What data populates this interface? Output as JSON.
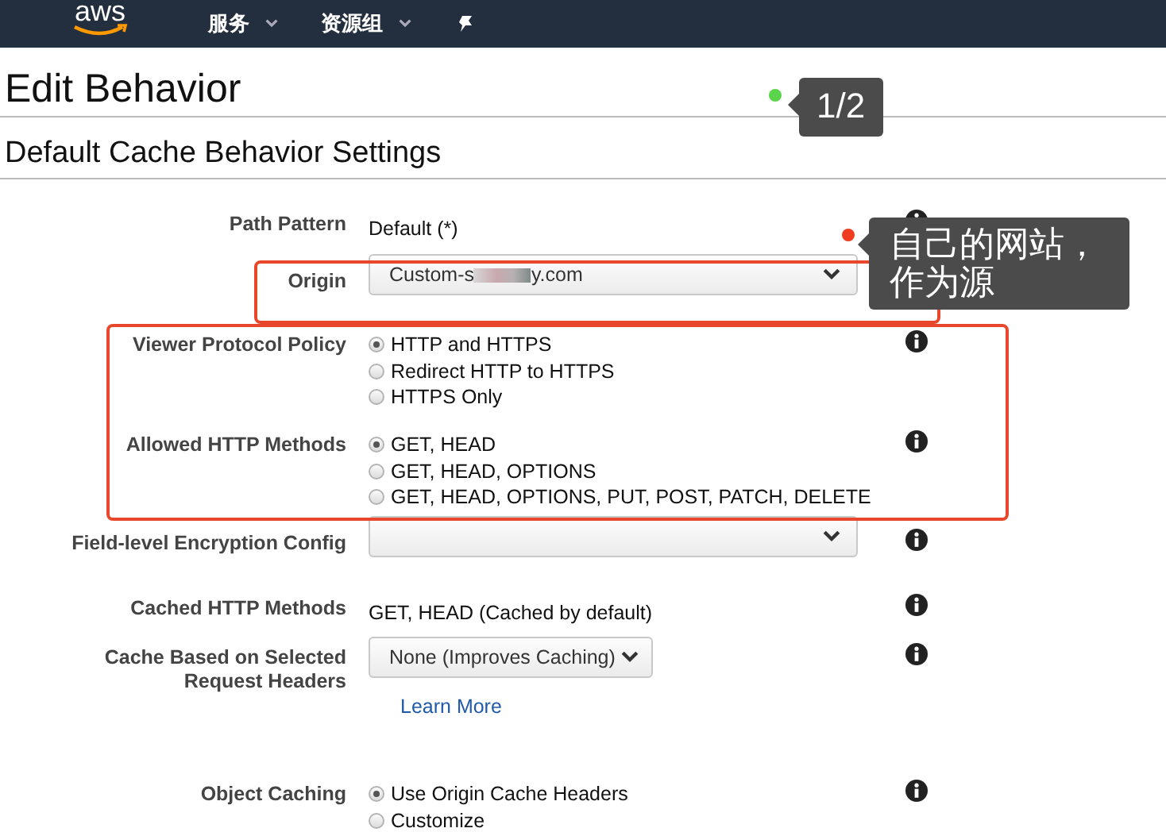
{
  "nav": {
    "logo": "aws",
    "menus": [
      {
        "label": "服务"
      },
      {
        "label": "资源组"
      }
    ]
  },
  "title": "Edit Behavior",
  "section_title": "Default Cache Behavior Settings",
  "fields": [
    {
      "kind": "text",
      "label": "Path Pattern",
      "value": "Default (*)"
    },
    {
      "kind": "select",
      "label": "Origin",
      "value": "Custom-s",
      "value_tail": "y.com"
    },
    {
      "kind": "radio",
      "label": "Viewer Protocol Policy",
      "options": [
        {
          "label": "HTTP and HTTPS",
          "selected": true
        },
        {
          "label": "Redirect HTTP to HTTPS",
          "selected": false
        },
        {
          "label": "HTTPS Only",
          "selected": false
        }
      ]
    },
    {
      "kind": "radio",
      "label": "Allowed HTTP Methods",
      "options": [
        {
          "label": "GET, HEAD",
          "selected": true
        },
        {
          "label": "GET, HEAD, OPTIONS",
          "selected": false
        },
        {
          "label": "GET, HEAD, OPTIONS, PUT, POST, PATCH, DELETE",
          "selected": false
        }
      ]
    },
    {
      "kind": "select",
      "label": "Field-level Encryption Config"
    },
    {
      "kind": "text",
      "label": "Cached HTTP Methods",
      "value": "GET, HEAD (Cached by default)"
    },
    {
      "kind": "dropdown",
      "label": "Cache Based on Selected Request Headers",
      "value": "None (Improves Caching)",
      "link": "Learn More"
    },
    {
      "kind": "radio",
      "label": "Object Caching",
      "options": [
        {
          "label": "Use Origin Cache Headers",
          "selected": true
        },
        {
          "label": "Customize",
          "selected": false
        }
      ]
    }
  ],
  "annotations": [
    {
      "text": "1/2",
      "color": "#5ad44a"
    },
    {
      "text": "自己的网站，作为源",
      "color": "#f03c1f"
    }
  ]
}
